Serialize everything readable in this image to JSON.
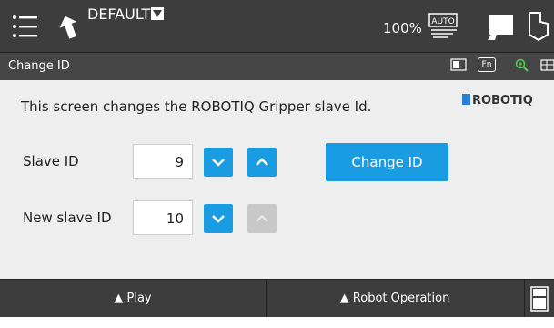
{
  "topbar": {
    "mode": "DEFAULT",
    "speed": "100%",
    "icons": [
      "menu-icon",
      "undo-icon",
      "mode-dropdown-icon",
      "auto-mode-icon",
      "robot-icon",
      "touch-hand-icon"
    ]
  },
  "subbar": {
    "title": "Change ID",
    "fn_label": "Fn",
    "icons": [
      "display-icon",
      "fn-icon",
      "zoom-in-icon",
      "window-split-icon"
    ]
  },
  "content": {
    "description": "This screen changes the ROBOTIQ Gripper slave Id.",
    "logo_text": "ROBOTIQ",
    "slave_id": {
      "label": "Slave ID",
      "value": "9"
    },
    "new_slave_id": {
      "label": "New slave ID",
      "value": "10"
    },
    "change_button": "Change ID",
    "accent": "#1a9ce3"
  },
  "bottombar": {
    "play": "▲ Play",
    "robot_operation": "▲ Robot Operation",
    "icons": [
      "panel-icon"
    ]
  }
}
